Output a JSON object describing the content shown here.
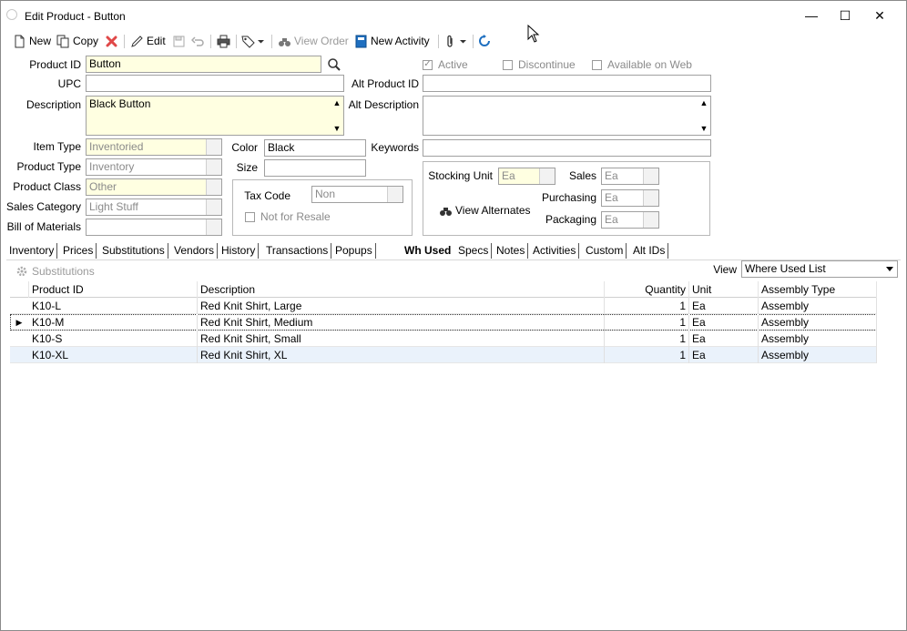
{
  "window": {
    "title": "Edit Product - Button",
    "minimize_glyph": "—",
    "maximize_glyph": "☐",
    "close_glyph": "✕"
  },
  "toolbar": {
    "new_label": "New",
    "copy_label": "Copy",
    "edit_label": "Edit",
    "view_order_label": "View Order",
    "new_activity_label": "New Activity"
  },
  "form": {
    "product_id_label": "Product ID",
    "product_id": "Button",
    "upc_label": "UPC",
    "upc": "",
    "description_label": "Description",
    "description": "Black Button",
    "active_label": "Active",
    "active_checked": true,
    "discontinue_label": "Discontinue",
    "available_web_label": "Available on Web",
    "alt_product_id_label": "Alt Product ID",
    "alt_product_id": "",
    "alt_description_label": "Alt Description",
    "alt_description": "",
    "item_type_label": "Item Type",
    "item_type": "Inventoried",
    "product_type_label": "Product Type",
    "product_type": "Inventory",
    "product_class_label": "Product Class",
    "product_class": "Other",
    "sales_category_label": "Sales Category",
    "sales_category": "Light Stuff",
    "bom_label": "Bill of Materials",
    "bom": "",
    "color_label": "Color",
    "color": "Black",
    "size_label": "Size",
    "size": "",
    "tax_code_label": "Tax Code",
    "tax_code": "Non",
    "not_for_resale_label": "Not for Resale",
    "keywords_label": "Keywords",
    "keywords": "",
    "stocking_unit_label": "Stocking Unit",
    "stocking_unit": "Ea",
    "sales_label": "Sales",
    "sales_unit": "Ea",
    "purchasing_label": "Purchasing",
    "purchasing_unit": "Ea",
    "packaging_label": "Packaging",
    "packaging_unit": "Ea",
    "view_alternates_label": "View Alternates"
  },
  "tabs": [
    "Inventory",
    "Prices",
    "Substitutions",
    "Vendors",
    "History",
    "Transactions",
    "Popups",
    "Wh Used",
    "Specs",
    "Notes",
    "Activities",
    "Custom",
    "Alt IDs"
  ],
  "active_tab": "Wh Used",
  "where_used": {
    "substitutions_label": "Substitutions",
    "view_label": "View",
    "view_value": "Where Used List",
    "columns": [
      "Product ID",
      "Description",
      "Quantity",
      "Unit",
      "Assembly Type"
    ],
    "rows": [
      {
        "product_id": "K10-L",
        "description": "Red Knit Shirt, Large",
        "quantity": "1",
        "unit": "Ea",
        "assembly_type": "Assembly"
      },
      {
        "product_id": "K10-M",
        "description": "Red Knit Shirt, Medium",
        "quantity": "1",
        "unit": "Ea",
        "assembly_type": "Assembly"
      },
      {
        "product_id": "K10-S",
        "description": "Red Knit Shirt, Small",
        "quantity": "1",
        "unit": "Ea",
        "assembly_type": "Assembly"
      },
      {
        "product_id": "K10-XL",
        "description": "Red Knit Shirt, XL",
        "quantity": "1",
        "unit": "Ea",
        "assembly_type": "Assembly"
      }
    ]
  },
  "colors": {
    "required_field_bg": "#ffffe1",
    "alt_row_bg": "#eaf2fb",
    "disabled_text": "#9a9a9a"
  }
}
